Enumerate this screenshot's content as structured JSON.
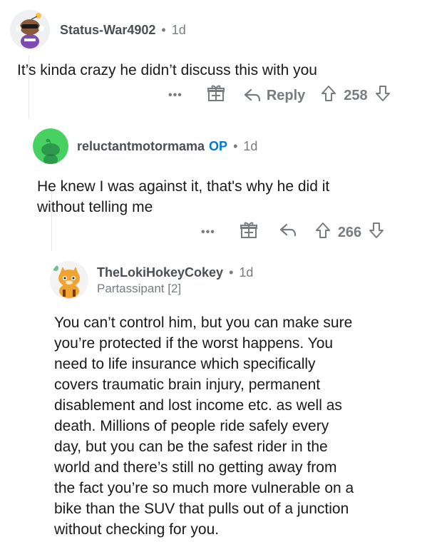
{
  "comments": [
    {
      "author": "Status-War4902",
      "separator": "•",
      "time": "1d",
      "body": "It’s kinda crazy he didn’t discuss this with you",
      "actions": {
        "more": "•••",
        "reply_label": "Reply",
        "votes": "258"
      }
    },
    {
      "author": "reluctantmotormama",
      "op_badge": "OP",
      "separator": "•",
      "time": "1d",
      "body_lines": [
        "He knew I was against it, that's why he did it",
        "without telling me"
      ],
      "actions": {
        "more": "•••",
        "votes": "266"
      }
    },
    {
      "author": "TheLokiHokeyCokey",
      "separator": "•",
      "time": "1d",
      "flair": "Partassipant [2]",
      "body_lines": [
        "You can’t control him, but you can make sure",
        "you’re protected if the worst happens. You",
        "need to life insurance which specifically",
        "covers traumatic brain injury, permanent",
        "disablement and lost income etc. as well as",
        "death. Millions of people ride safely every",
        "day, but you can be the safest rider in the",
        "world and there’s still no getting away from",
        "the fact you’re so much more vulnerable on a",
        "bike than the SUV that pulls out of a junction",
        "without checking for you."
      ]
    }
  ],
  "colors": {
    "meta": "#787c7e",
    "op": "#0079d3",
    "text": "#1a1a1b",
    "avatar2_bg": "#46d160"
  },
  "icons": [
    "snoo-avatar",
    "gift-icon",
    "reply-icon",
    "upvote-icon",
    "downvote-icon",
    "more-icon"
  ]
}
